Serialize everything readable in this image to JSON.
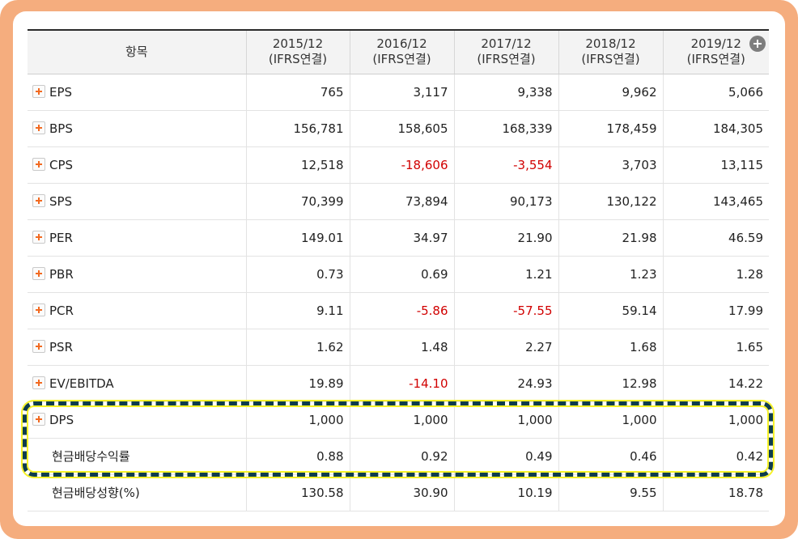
{
  "table": {
    "corner_header": "항목",
    "columns": [
      {
        "period": "2015/12",
        "basis": "(IFRS연결)"
      },
      {
        "period": "2016/12",
        "basis": "(IFRS연결)"
      },
      {
        "period": "2017/12",
        "basis": "(IFRS연결)"
      },
      {
        "period": "2018/12",
        "basis": "(IFRS연결)"
      },
      {
        "period": "2019/12",
        "basis": "(IFRS연결)"
      }
    ],
    "rows": [
      {
        "label": "EPS",
        "values": [
          "765",
          "3,117",
          "9,338",
          "9,962",
          "5,066"
        ]
      },
      {
        "label": "BPS",
        "values": [
          "156,781",
          "158,605",
          "168,339",
          "178,459",
          "184,305"
        ]
      },
      {
        "label": "CPS",
        "values": [
          "12,518",
          "-18,606",
          "-3,554",
          "3,703",
          "13,115"
        ]
      },
      {
        "label": "SPS",
        "values": [
          "70,399",
          "73,894",
          "90,173",
          "130,122",
          "143,465"
        ]
      },
      {
        "label": "PER",
        "values": [
          "149.01",
          "34.97",
          "21.90",
          "21.98",
          "46.59"
        ]
      },
      {
        "label": "PBR",
        "values": [
          "0.73",
          "0.69",
          "1.21",
          "1.23",
          "1.28"
        ]
      },
      {
        "label": "PCR",
        "values": [
          "9.11",
          "-5.86",
          "-57.55",
          "59.14",
          "17.99"
        ]
      },
      {
        "label": "PSR",
        "values": [
          "1.62",
          "1.48",
          "2.27",
          "1.68",
          "1.65"
        ]
      },
      {
        "label": "EV/EBITDA",
        "values": [
          "19.89",
          "-14.10",
          "24.93",
          "12.98",
          "14.22"
        ]
      },
      {
        "label": "DPS",
        "values": [
          "1,000",
          "1,000",
          "1,000",
          "1,000",
          "1,000"
        ]
      },
      {
        "label": "현금배당수익률",
        "values": [
          "0.88",
          "0.92",
          "0.49",
          "0.46",
          "0.42"
        ]
      },
      {
        "label": "현금배당성향(%)",
        "values": [
          "130.58",
          "30.90",
          "10.19",
          "9.55",
          "18.78"
        ]
      }
    ]
  },
  "colors": {
    "frame_background": "#f5ad7e",
    "negative_value": "#d10000",
    "expand_icon": "#f26a21",
    "highlight_dash": "#0e3c4c",
    "highlight_glow": "#f6f22a"
  },
  "icons": {
    "row_expand": "plus-square-icon",
    "add_column": "plus-circle-icon"
  }
}
